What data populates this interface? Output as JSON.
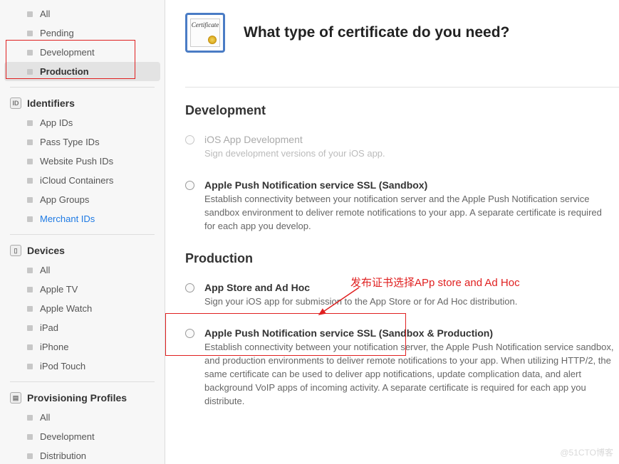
{
  "sidebar": {
    "top_items": [
      {
        "label": "All"
      },
      {
        "label": "Pending"
      },
      {
        "label": "Development"
      },
      {
        "label": "Production",
        "selected": true
      }
    ],
    "sections": [
      {
        "title": "Identifiers",
        "icon": "ID",
        "items": [
          {
            "label": "App IDs"
          },
          {
            "label": "Pass Type IDs"
          },
          {
            "label": "Website Push IDs"
          },
          {
            "label": "iCloud Containers"
          },
          {
            "label": "App Groups"
          },
          {
            "label": "Merchant IDs",
            "link": true
          }
        ]
      },
      {
        "title": "Devices",
        "icon": "▯",
        "items": [
          {
            "label": "All"
          },
          {
            "label": "Apple TV"
          },
          {
            "label": "Apple Watch"
          },
          {
            "label": "iPad"
          },
          {
            "label": "iPhone"
          },
          {
            "label": "iPod Touch"
          }
        ]
      },
      {
        "title": "Provisioning Profiles",
        "icon": "▤",
        "items": [
          {
            "label": "All"
          },
          {
            "label": "Development"
          },
          {
            "label": "Distribution"
          }
        ]
      }
    ]
  },
  "main": {
    "cert_word": "Certificate",
    "title": "What type of certificate do you need?",
    "dev_heading": "Development",
    "prod_heading": "Production",
    "options_dev": [
      {
        "title": "iOS App Development",
        "desc": "Sign development versions of your iOS app.",
        "disabled": true
      },
      {
        "title": "Apple Push Notification service SSL (Sandbox)",
        "desc": "Establish connectivity between your notification server and the Apple Push Notification service sandbox environment to deliver remote notifications to your app. A separate certificate is required for each app you develop."
      }
    ],
    "options_prod": [
      {
        "title": "App Store and Ad Hoc",
        "desc": "Sign your iOS app for submission to the App Store or for Ad Hoc distribution."
      },
      {
        "title": "Apple Push Notification service SSL (Sandbox & Production)",
        "desc": "Establish connectivity between your notification server, the Apple Push Notification service sandbox, and production environments to deliver remote notifications to your app. When utilizing HTTP/2, the same certificate can be used to deliver app notifications, update complication data, and alert background VoIP apps of incoming activity. A separate certificate is required for each app you distribute."
      }
    ]
  },
  "annotation": "发布证书选择APp store and Ad Hoc",
  "watermark": "@51CTO博客"
}
